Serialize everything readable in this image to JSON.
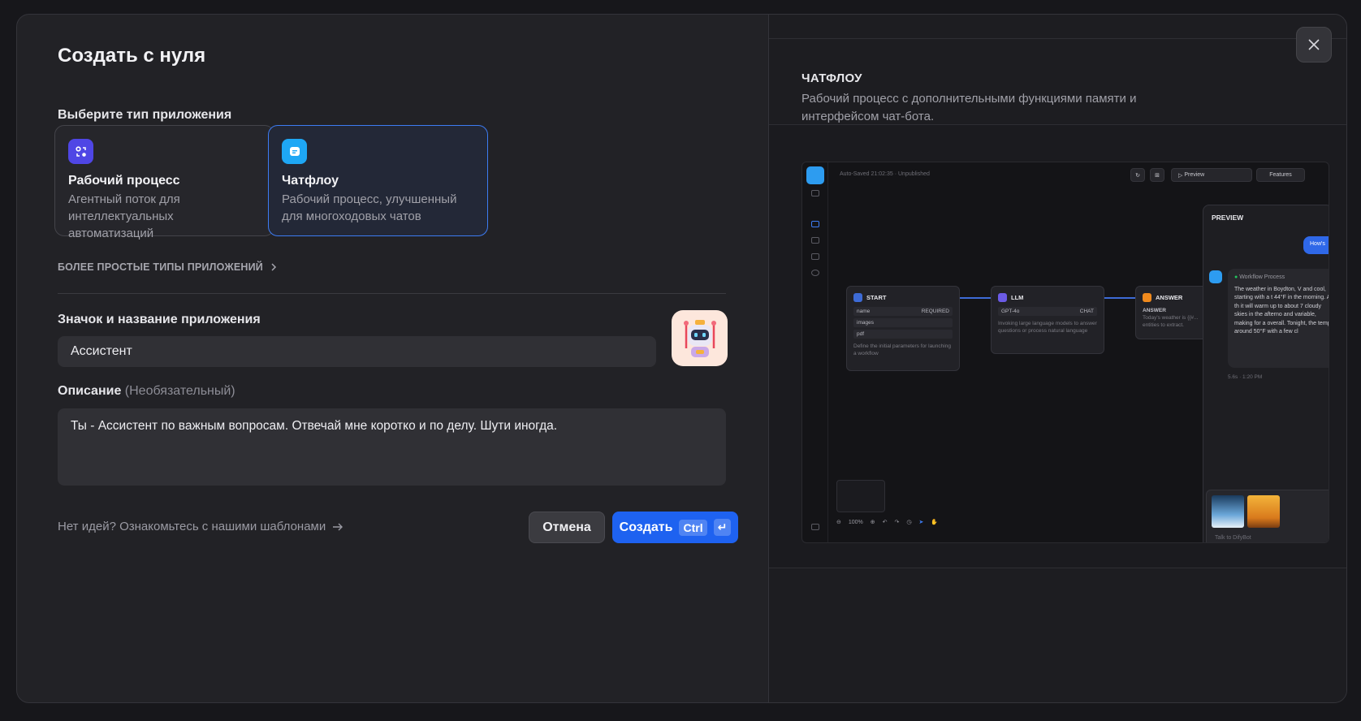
{
  "dialog": {
    "title": "Создать с нуля",
    "type_section_label": "Выберите тип приложения",
    "types": [
      {
        "name": "Рабочий процесс",
        "description": "Агентный поток для интеллектуальных автоматизаций",
        "icon": "workflow-icon",
        "color": "#4f46e5"
      },
      {
        "name": "Чатфлоу",
        "description": "Рабочий процесс, улучшенный для многоходовых чатов",
        "icon": "chatflow-icon",
        "color": "#1ea7f5"
      }
    ],
    "selected_type": "Чатфлоу",
    "simpler_types_label": "БОЛЕЕ ПРОСТЫЕ ТИПЫ ПРИЛОЖЕНИЙ",
    "name_section_label": "Значок и название приложения",
    "app_name": "Ассистент",
    "app_icon": "robot-icon",
    "description_label": "Описание",
    "description_optional": "(Необязательный)",
    "description_value": "Ты - Ассистент по важным вопросам. Отвечай мне коротко и по делу. Шути иногда.",
    "templates_link": "Нет идей? Ознакомьтесь с нашими шаблонами",
    "cancel_label": "Отмена",
    "create_label": "Создать",
    "shortcut_ctrl": "Ctrl",
    "shortcut_enter": "↵",
    "accent_color": "#1e62f0"
  },
  "preview": {
    "title": "ЧАТФЛОУ",
    "description": "Рабочий процесс с дополнительными функциями памяти и интерфейсом чат-бота.",
    "mock": {
      "autosaved": "Auto-Saved 21:02:35 · Unpublished",
      "preview_btn": "Preview",
      "features_btn": "Features",
      "nodes": {
        "start": {
          "title": "START",
          "rows": [
            "name",
            "images",
            "pdf"
          ],
          "required": "REQUIRED",
          "footer": "Define the initial parameters for launching a workflow"
        },
        "llm": {
          "title": "LLM",
          "model": "GPT-4o",
          "mode": "CHAT",
          "footer": "Invoking large language models to answer questions or process natural language"
        },
        "answer": {
          "title": "ANSWER",
          "label": "ANSWER",
          "text": "Today's weather is {{#...",
          "text2": "entities to extract."
        }
      },
      "chat": {
        "title": "PREVIEW",
        "user_msg": "How's",
        "process": "Workflow Process",
        "reply": "The weather in Boydton, V and cool, starting with a t 44°F in the morning. As th it will warm up to about 7 cloudy skies in the afterno and variable, making for a overall. Tonight, the temp around 50°F with a few cl",
        "time": "5.6s · 1:20 PM",
        "input_placeholder": "Talk to DifyBot"
      },
      "zoom": "100%"
    }
  }
}
